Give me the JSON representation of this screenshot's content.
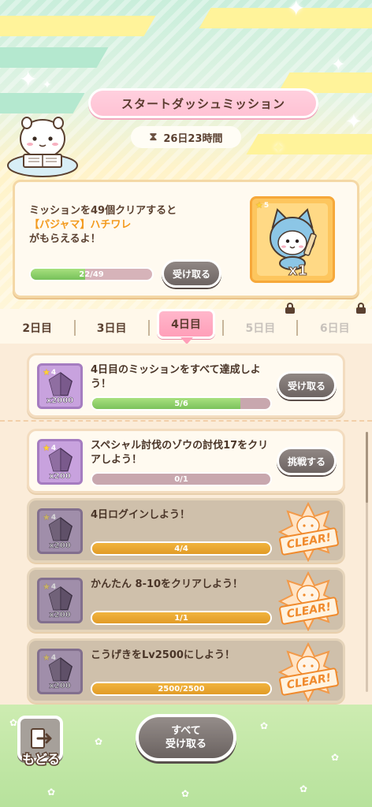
{
  "header": {
    "title": "スタートダッシュミッション",
    "timer": "26日23時間"
  },
  "reward": {
    "line1": "ミッションを49個クリアすると",
    "highlight": "【パジャマ】ハチワレ",
    "line3": "がもらえるよ！",
    "progress_text": "22/49",
    "progress": 0.449,
    "claim_label": "受け取る",
    "rarity": "5",
    "quantity": "x1"
  },
  "tabs": [
    {
      "label": "2日目",
      "locked": false
    },
    {
      "label": "3日目",
      "locked": false
    },
    {
      "label": "4日目",
      "locked": false,
      "active": true
    },
    {
      "label": "5日目",
      "locked": true
    },
    {
      "label": "6日目",
      "locked": true
    }
  ],
  "missions": [
    {
      "title": "4日目のミッションをすべて達成しよう！",
      "rarity": "4",
      "count": "x2000",
      "progress_text": "5/6",
      "progress": 0.833,
      "button": "受け取る",
      "state": "claimable"
    },
    {
      "title": "スペシャル討伐のゾウの討伐17をクリアしよう！",
      "rarity": "4",
      "count": "x200",
      "progress_text": "0/1",
      "progress": 0,
      "button": "挑戦する",
      "state": "challenge"
    },
    {
      "title": "4日ログインしよう！",
      "rarity": "4",
      "count": "x200",
      "progress_text": "4/4",
      "progress": 1,
      "stamp": "CLEAR!",
      "state": "clear"
    },
    {
      "title": "かんたん 8-10をクリアしよう！",
      "rarity": "4",
      "count": "x200",
      "progress_text": "1/1",
      "progress": 1,
      "stamp": "CLEAR!",
      "state": "clear"
    },
    {
      "title": "こうげきをLv2500にしよう！",
      "rarity": "4",
      "count": "x200",
      "progress_text": "2500/2500",
      "progress": 1,
      "stamp": "CLEAR!",
      "state": "clear"
    }
  ],
  "footer": {
    "back_label": "もどる",
    "claim_all_line1": "すべて",
    "claim_all_line2": "受け取る"
  },
  "colors": {
    "accent_pink": "#ff9fb9",
    "progress_green": "#7bc35c",
    "progress_orange": "#e19b27",
    "button_gray": "#6d6462",
    "highlight_orange": "#f39a1e"
  }
}
